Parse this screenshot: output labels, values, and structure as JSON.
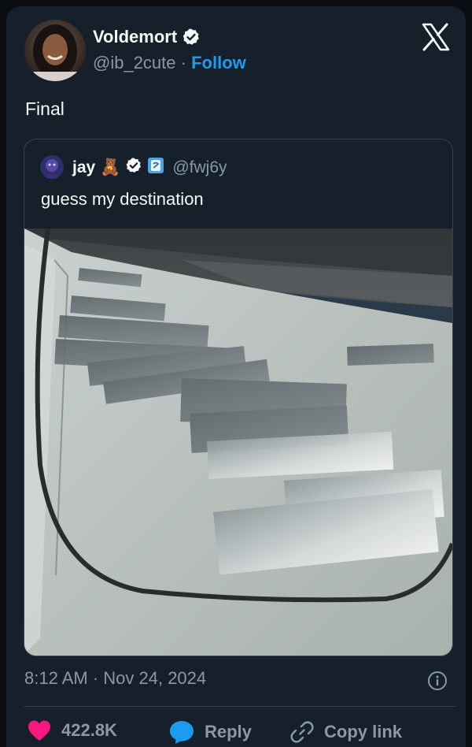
{
  "author": {
    "display_name": "Voldemort",
    "handle": "@ib_2cute",
    "separator": "·",
    "follow_label": "Follow"
  },
  "tweet": {
    "text": "Final",
    "timestamp": "8:12 AM · Nov 24, 2024"
  },
  "quoted_tweet": {
    "display_name": "jay",
    "emoji": "🧸",
    "handle": "@fwj6y",
    "text": "guess my destination"
  },
  "actions": {
    "likes_count": "422.8K",
    "reply_label": "Reply",
    "copy_link_label": "Copy link"
  },
  "colors": {
    "background": "#15202b",
    "accent": "#1d9bf0",
    "like": "#f91880",
    "muted_text": "#8b98a5",
    "border": "#38444d"
  },
  "icons": [
    "x-logo-icon",
    "verified-badge-icon",
    "affiliate-badge-icon",
    "heart-icon",
    "reply-bubble-icon",
    "link-icon",
    "info-icon"
  ]
}
